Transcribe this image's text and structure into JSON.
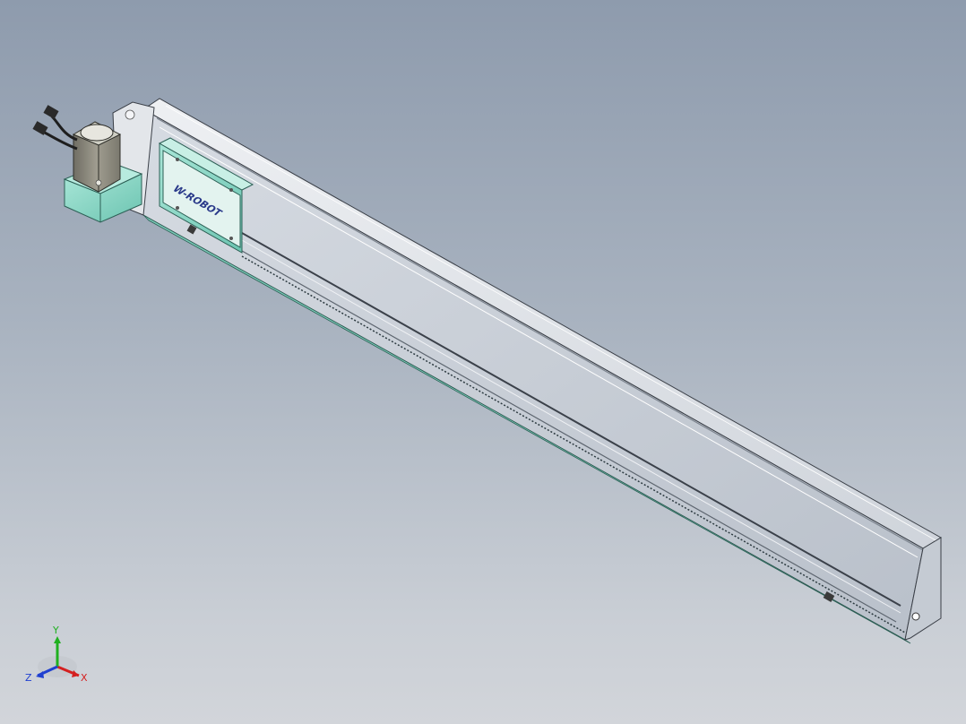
{
  "viewport": {
    "background_top": "#8e9bad",
    "background_bottom": "#d2d5da"
  },
  "model": {
    "carriage_logo_text": "W-ROBOT",
    "profile_color": "#d9dde3",
    "accent_color": "#86d5c4",
    "motor_color": "#8c8a7e"
  },
  "triad": {
    "x_label": "X",
    "y_label": "Y",
    "z_label": "Z",
    "x_color": "#d42020",
    "y_color": "#20b020",
    "z_color": "#2040d0"
  }
}
